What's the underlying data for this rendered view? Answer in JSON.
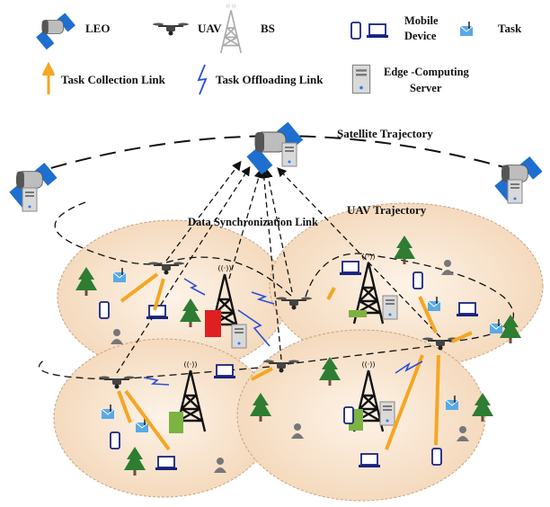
{
  "legend": {
    "leo": "LEO",
    "uav": "UAV",
    "bs": "BS",
    "mobile_device_line1": "Mobile",
    "mobile_device_line2": "Device",
    "task": "Task",
    "task_collection_link": "Task Collection Link",
    "task_offloading_link": "Task Offloading Link",
    "edge_server_line1": "Edge -Computing",
    "edge_server_line2": "Server"
  },
  "annotations": {
    "satellite_trajectory": "Satellite Trajectory",
    "data_sync_link": "Data Synchronization Link",
    "uav_trajectory": "UAV Trajectory"
  },
  "colors": {
    "collection_link": "#f5a623",
    "offloading_link": "#2b4fd8",
    "cell_fill": "#f7dfc6",
    "solar_panel": "#1e6fd0",
    "tree": "#2e7d32",
    "server_red": "#e02020",
    "server_green": "#7cb342"
  }
}
